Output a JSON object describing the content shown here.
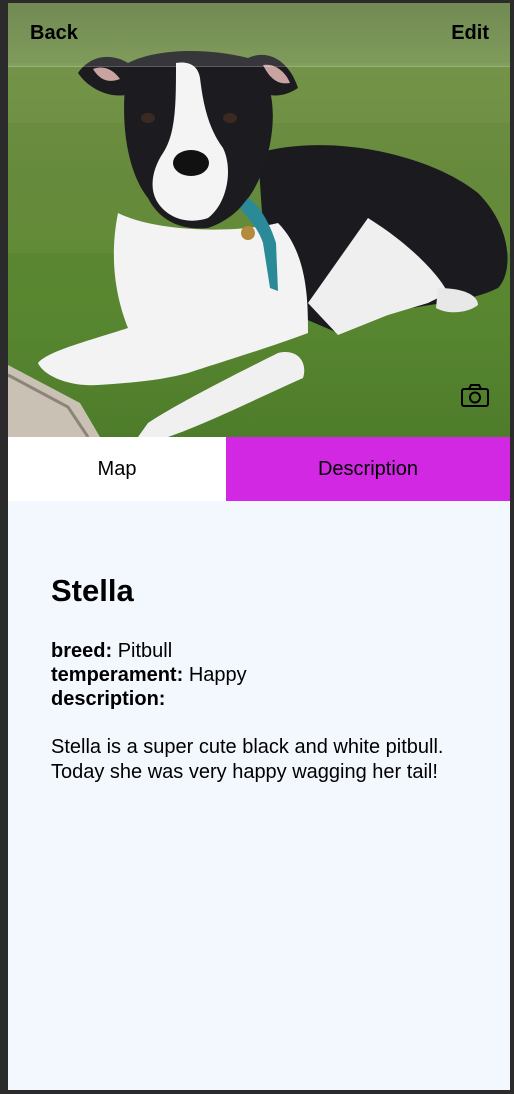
{
  "header": {
    "back_label": "Back",
    "edit_label": "Edit"
  },
  "photo": {
    "subject": "black and white pitbull lying on grass",
    "camera_icon": "camera-icon"
  },
  "tabs": [
    {
      "label": "Map",
      "active": false
    },
    {
      "label": "Description",
      "active": true
    }
  ],
  "colors": {
    "active_tab": "#d228e3",
    "inactive_tab": "#ffffff",
    "content_bg": "#f2f8fd"
  },
  "pet": {
    "name": "Stella",
    "breed_label": "breed:",
    "breed": "Pitbull",
    "temperament_label": "temperament:",
    "temperament": "Happy",
    "description_label": "description:",
    "description": "Stella is a super cute black and white pitbull. Today she was very happy wagging her tail!"
  }
}
